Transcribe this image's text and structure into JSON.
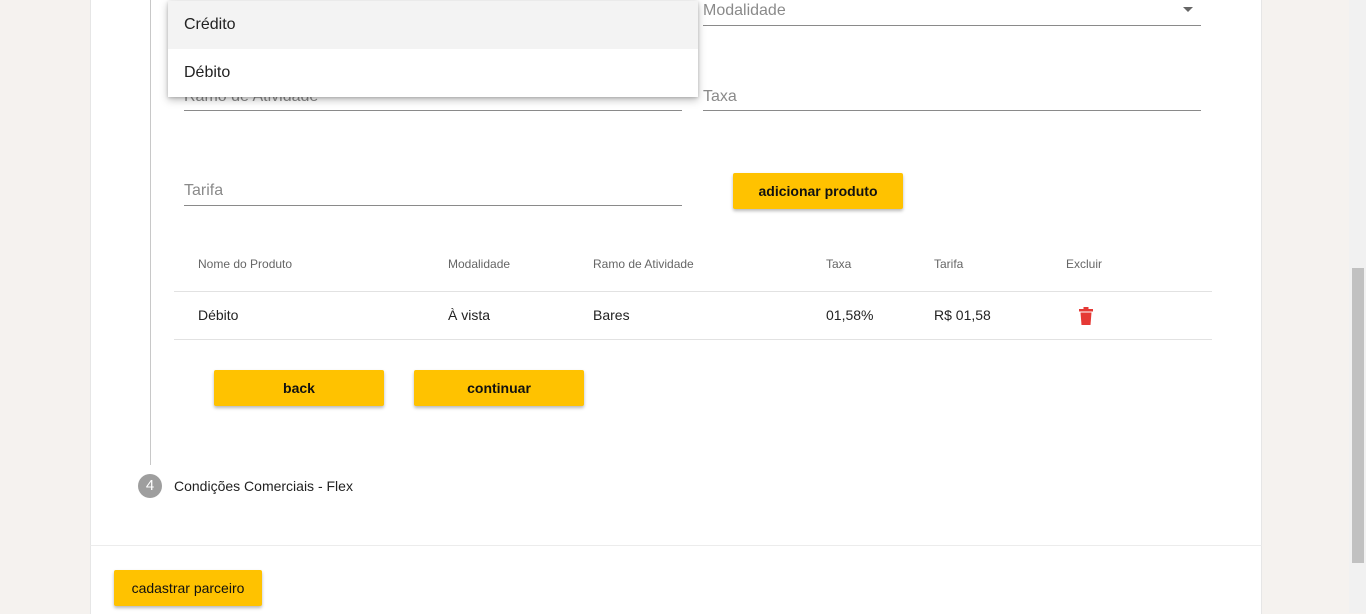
{
  "form": {
    "modalidade_label": "Modalidade",
    "ramo_label": "Ramo de Atividade",
    "taxa_label": "Taxa",
    "tarifa_label": "Tarifa",
    "add_product_label": "adicionar produto"
  },
  "dropdown": {
    "options": [
      {
        "label": "Crédito",
        "active": true
      },
      {
        "label": "Débito",
        "active": false
      }
    ]
  },
  "table": {
    "headers": [
      "Nome do Produto",
      "Modalidade",
      "Ramo de Atividade",
      "Taxa",
      "Tarifa",
      "Excluir"
    ],
    "rows": [
      {
        "nome": "Débito",
        "modalidade": "À vista",
        "ramo": "Bares",
        "taxa": "01,58%",
        "tarifa": "R$ 01,58",
        "delete_icon": "trash-icon"
      }
    ],
    "delete_color": "#e53935"
  },
  "actions": {
    "back_label": "back",
    "continue_label": "continuar"
  },
  "stepper": {
    "step_number": "4",
    "step_label": "Condições Comerciais - Flex"
  },
  "footer": {
    "submit_label": "cadastrar parceiro"
  },
  "colors": {
    "accent": "#ffc200",
    "background": "#f5f2ef"
  }
}
